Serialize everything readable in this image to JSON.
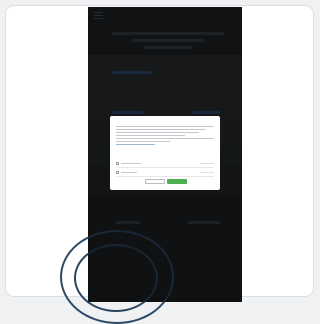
{
  "colors": {
    "page_background": "#f0f1f2",
    "phone_background": "#232628",
    "accept_button": "#4caf50",
    "link_accent": "#2b4a6e"
  },
  "modal": {
    "title": "Cookie Consent",
    "consent_rows": [
      {
        "icon": "checkbox"
      },
      {
        "icon": "checkbox"
      }
    ],
    "buttons": [
      "secondary",
      "primary"
    ]
  },
  "icons": {
    "menu": "hamburger-menu-icon"
  }
}
